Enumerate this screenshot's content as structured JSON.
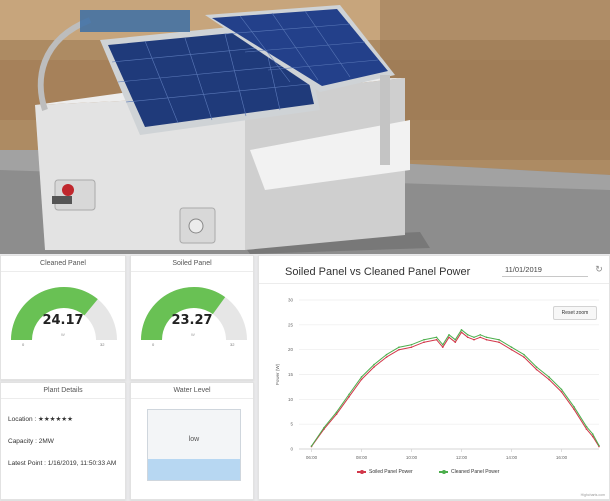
{
  "gauges": [
    {
      "title": "Cleaned Panel",
      "value": "24.17",
      "fraction": 0.72,
      "min": "0",
      "max": "32",
      "unit": "W",
      "color": "#69c154"
    },
    {
      "title": "Soiled Panel",
      "value": "23.27",
      "fraction": 0.7,
      "min": "0",
      "max": "32",
      "unit": "W",
      "color": "#69c154"
    }
  ],
  "plant_details": {
    "title": "Plant Details",
    "location": "Location : ★★★★★★",
    "capacity": "Capacity : 2MW",
    "latest_point": "Latest Point : 1/16/2019, 11:50:33 AM"
  },
  "water_level": {
    "title": "Water Level",
    "label": "low",
    "fraction": 0.3,
    "water_color": "#b7d7f2"
  },
  "chart_panel": {
    "date_value": "11/01/2019",
    "reset_label": "Reset zoom",
    "credit": "Highcharts.com"
  },
  "chart_data": {
    "type": "line",
    "title": "Soiled Panel vs Cleaned Panel Power",
    "ylabel": "Power (W)",
    "xlabel": "",
    "ylim": [
      0,
      30
    ],
    "yticks": [
      "0",
      "5",
      "10",
      "15",
      "20",
      "25",
      "30"
    ],
    "xticks": [
      "06:00",
      "08:00",
      "10:00",
      "12:00",
      "14:00",
      "16:00"
    ],
    "x": [
      "06:00",
      "06:30",
      "07:00",
      "07:30",
      "08:00",
      "08:30",
      "09:00",
      "09:30",
      "10:00",
      "10:30",
      "11:00",
      "11:15",
      "11:30",
      "11:45",
      "12:00",
      "12:15",
      "12:30",
      "12:45",
      "13:00",
      "13:30",
      "14:00",
      "14:30",
      "15:00",
      "15:30",
      "16:00",
      "16:30",
      "17:00",
      "17:15",
      "17:30"
    ],
    "series": [
      {
        "name": "Soiled Panel Power",
        "color": "#d2374a",
        "values": [
          0.5,
          4,
          7,
          10.5,
          14,
          16.5,
          18.5,
          20,
          20.5,
          21.5,
          22,
          20.5,
          22.5,
          21.5,
          23.5,
          22.5,
          22,
          22.5,
          22,
          21.5,
          20,
          18.5,
          16,
          14,
          11.5,
          8,
          4,
          2.5,
          0.5
        ]
      },
      {
        "name": "Cleaned Panel Power",
        "color": "#4cae4c",
        "values": [
          0.6,
          4.3,
          7.4,
          11,
          14.5,
          17,
          19,
          20.5,
          21,
          22,
          22.5,
          21,
          23,
          22,
          24,
          23,
          22.5,
          23,
          22.5,
          22,
          20.5,
          19,
          16.5,
          14.5,
          12,
          8.5,
          4.5,
          3,
          0.7
        ]
      }
    ]
  }
}
